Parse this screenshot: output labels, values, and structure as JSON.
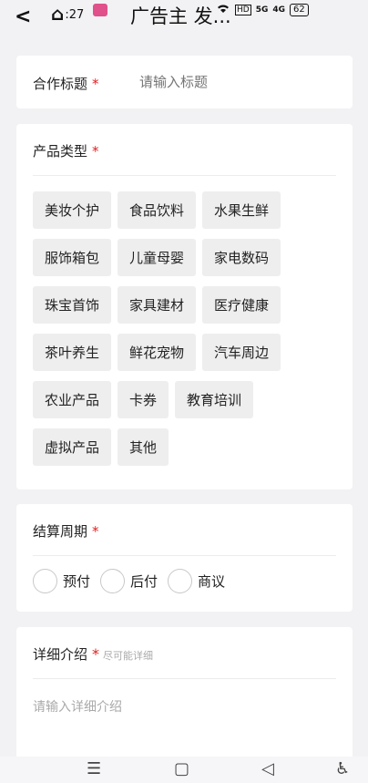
{
  "status_bar": {
    "back_glyph": "<",
    "home_glyph": "⌂",
    "time": ":27",
    "title": "广告主 发...",
    "battery": "62",
    "signal_1": "5G",
    "signal_2": "4G",
    "hd": "HD"
  },
  "cooperation_title": {
    "label": "合作标题",
    "required": "*",
    "placeholder": "请输入标题"
  },
  "product_type": {
    "label": "产品类型",
    "required": "*",
    "options": [
      [
        "美妆个护",
        "食品饮料",
        "水果生鲜"
      ],
      [
        "服饰箱包",
        "儿童母婴",
        "家电数码"
      ],
      [
        "珠宝首饰",
        "家具建材",
        "医疗健康"
      ],
      [
        "茶叶养生",
        "鲜花宠物",
        "汽车周边"
      ],
      [
        "农业产品",
        "卡券",
        "教育培训"
      ],
      [
        "虚拟产品",
        "其他"
      ]
    ]
  },
  "settlement": {
    "label": "结算周期",
    "required": "*",
    "options": [
      "预付",
      "后付",
      "商议"
    ]
  },
  "details": {
    "label": "详细介绍",
    "required": "*",
    "hint": "尽可能详细",
    "placeholder": "请输入详细介绍"
  },
  "nav": {
    "menu": "☰",
    "home": "▢",
    "back": "◁",
    "accessibility": "♿"
  }
}
